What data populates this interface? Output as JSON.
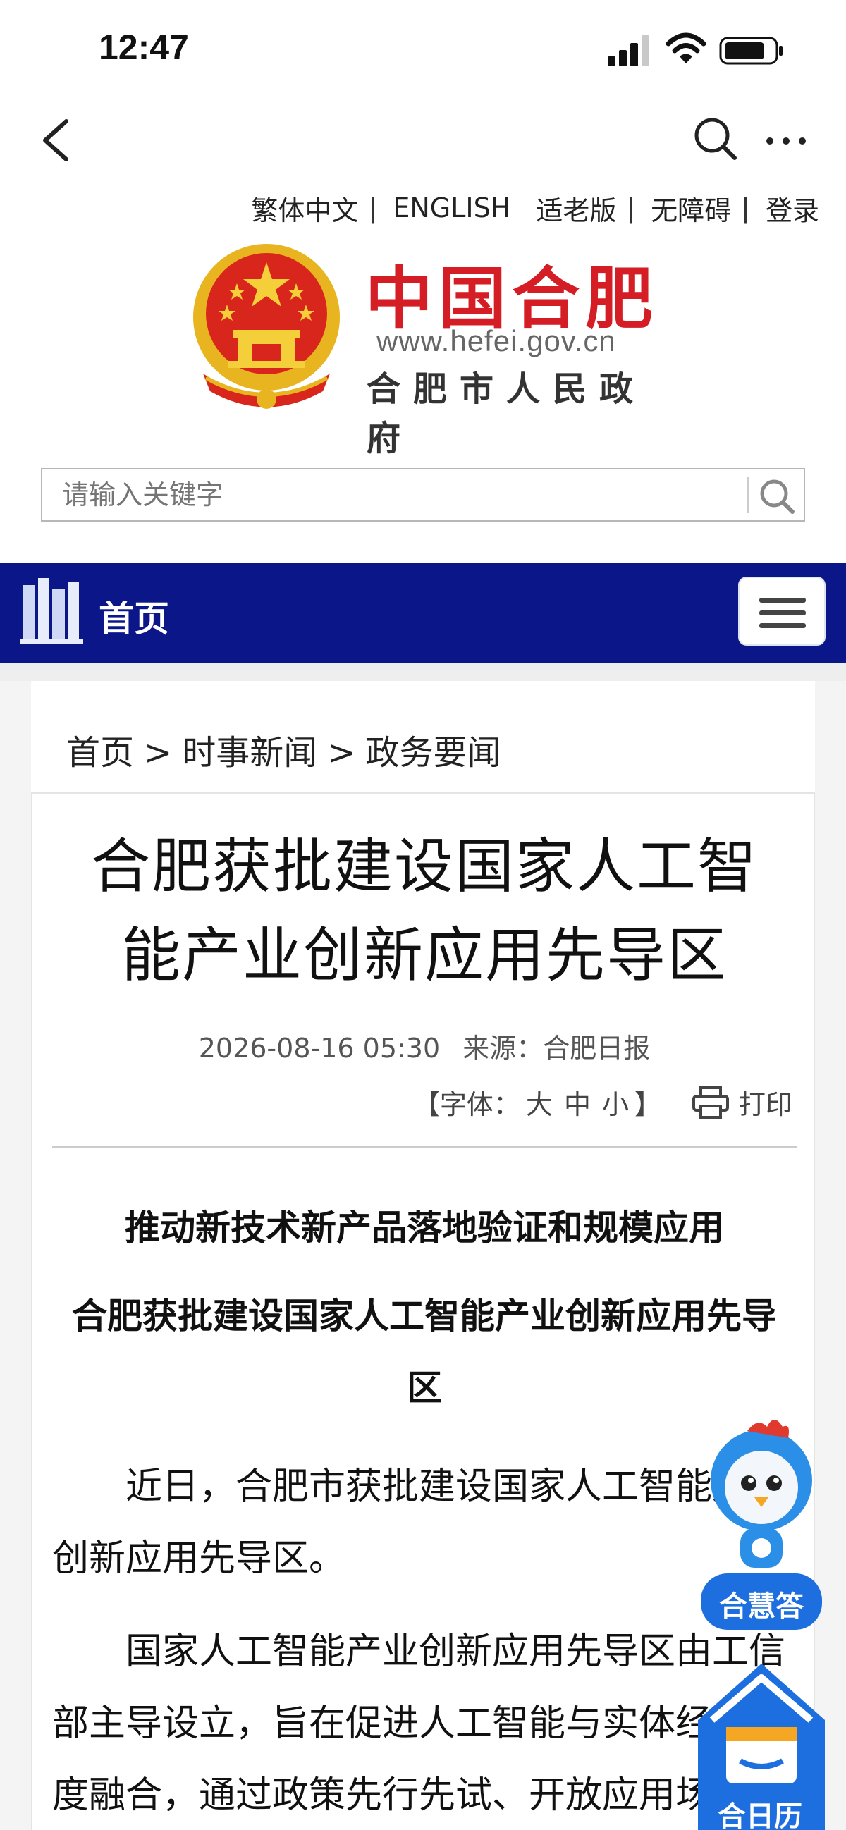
{
  "status": {
    "time": "12:47"
  },
  "top_links": [
    "繁体中文",
    "ENGLISH",
    "适老版",
    "无障碍",
    "登录"
  ],
  "logo": {
    "title": "中国合肥",
    "url": "www.hefei.gov.cn",
    "subtitle": "合肥市人民政府"
  },
  "search": {
    "placeholder": "请输入关键字"
  },
  "nav": {
    "home": "首页"
  },
  "breadcrumb": [
    "首页",
    "时事新闻",
    "政务要闻"
  ],
  "article": {
    "title": "合肥获批建设国家人工智能产业创新应用先导区",
    "date": "2026-08-16 05:30",
    "source": "来源：合肥日报",
    "font_label_open": "【字体：",
    "font_sizes": [
      "大",
      "中",
      "小"
    ],
    "font_label_close": "】",
    "print": "打印",
    "heading1": "推动新技术新产品落地验证和规模应用",
    "heading2": "合肥获批建设国家人工智能产业创新应用先导区",
    "paragraphs": [
      "近日，合肥市获批建设国家人工智能产业创新应用先导区。",
      "国家人工智能产业创新应用先导区由工信部主导设立，旨在促进人工智能与实体经济深度融合，通过政策先行先试、开放应用场"
    ]
  },
  "floating": {
    "assistant": "合慧答",
    "calendar": "合日历"
  },
  "colors": {
    "brand_red": "#d41d24",
    "nav_blue": "#0b1789"
  }
}
